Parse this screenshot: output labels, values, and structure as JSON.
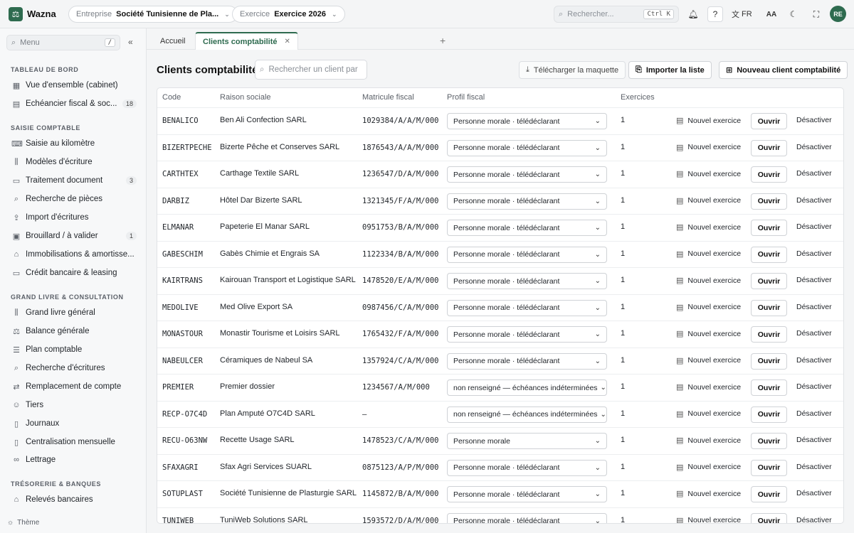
{
  "app": {
    "name": "Wazna",
    "logo_icon": "scales-icon",
    "brand_color": "#2e6b4f"
  },
  "topbar": {
    "entreprise": {
      "label": "Entreprise",
      "value": "Société Tunisienne de Pla..."
    },
    "exercice": {
      "label": "Exercice",
      "value": "Exercice 2026"
    },
    "search": {
      "placeholder": "Rechercher...",
      "shortcut": "Ctrl K"
    },
    "help": "?",
    "lang": "FR",
    "font_toggle": "AA",
    "avatar": "RE"
  },
  "sidebar": {
    "search_placeholder": "Menu",
    "search_shortcut": "/",
    "sections": [
      {
        "title": "TABLEAU DE BORD",
        "items": [
          {
            "label": "Vue d'ensemble (cabinet)",
            "icon": "grid-icon",
            "badge": ""
          },
          {
            "label": "Échéancier fiscal & soc...",
            "icon": "calendar-icon",
            "badge": "18"
          }
        ]
      },
      {
        "title": "SAISIE COMPTABLE",
        "items": [
          {
            "label": "Saisie au kilomètre",
            "icon": "keyboard-icon",
            "badge": ""
          },
          {
            "label": "Modèles d'écriture",
            "icon": "library-icon",
            "badge": ""
          },
          {
            "label": "Traitement document",
            "icon": "document-icon",
            "badge": "3"
          },
          {
            "label": "Recherche de pièces",
            "icon": "search-icon",
            "badge": ""
          },
          {
            "label": "Import d'écritures",
            "icon": "upload-icon",
            "badge": ""
          },
          {
            "label": "Brouillard / à valider",
            "icon": "clipboard-icon",
            "badge": "1"
          },
          {
            "label": "Immobilisations & amortisse...",
            "icon": "building-icon",
            "badge": ""
          },
          {
            "label": "Crédit bancaire & leasing",
            "icon": "card-icon",
            "badge": ""
          }
        ]
      },
      {
        "title": "GRAND LIVRE & CONSULTATION",
        "items": [
          {
            "label": "Grand livre général",
            "icon": "library-icon",
            "badge": ""
          },
          {
            "label": "Balance générale",
            "icon": "scales-icon",
            "badge": ""
          },
          {
            "label": "Plan comptable",
            "icon": "list-icon",
            "badge": ""
          },
          {
            "label": "Recherche d'écritures",
            "icon": "search-icon",
            "badge": ""
          },
          {
            "label": "Remplacement de compte",
            "icon": "swap-icon",
            "badge": ""
          },
          {
            "label": "Tiers",
            "icon": "users-icon",
            "badge": ""
          },
          {
            "label": "Journaux",
            "icon": "book-icon",
            "badge": ""
          },
          {
            "label": "Centralisation mensuelle",
            "icon": "file-icon",
            "badge": ""
          },
          {
            "label": "Lettrage",
            "icon": "link-icon",
            "badge": ""
          }
        ]
      },
      {
        "title": "TRÉSORERIE & BANQUES",
        "items": [
          {
            "label": "Relevés bancaires",
            "icon": "bank-icon",
            "badge": ""
          }
        ]
      }
    ],
    "theme_label": "Thème"
  },
  "tabs": [
    {
      "label": "Accueil",
      "active": false
    },
    {
      "label": "Clients comptabilité",
      "active": true
    }
  ],
  "page": {
    "title": "Clients comptabilité",
    "search_placeholder": "Rechercher un client par",
    "buttons": {
      "download": "Télécharger la maquette",
      "import": "Importer la liste",
      "new_client": "Nouveau client comptabilité"
    }
  },
  "table": {
    "headers": [
      "Code",
      "Raison sociale",
      "Matricule fiscal",
      "Profil fiscal",
      "Exercices"
    ],
    "row_actions": {
      "new_exercise": "Nouvel exercice",
      "open": "Ouvrir",
      "deactivate": "Désactiver"
    },
    "rows": [
      {
        "code": "BENALICO",
        "raison": "Ben Ali Confection SARL",
        "matricule": "1029384/A/A/M/000",
        "profil": "Personne morale · télédéclarant",
        "exercices": "1"
      },
      {
        "code": "BIZERTPECHE",
        "raison": "Bizerte Pêche et Conserves SARL",
        "matricule": "1876543/A/A/M/000",
        "profil": "Personne morale · télédéclarant",
        "exercices": "1"
      },
      {
        "code": "CARTHTEX",
        "raison": "Carthage Textile SARL",
        "matricule": "1236547/D/A/M/000",
        "profil": "Personne morale · télédéclarant",
        "exercices": "1"
      },
      {
        "code": "DARBIZ",
        "raison": "Hôtel Dar Bizerte SARL",
        "matricule": "1321345/F/A/M/000",
        "profil": "Personne morale · télédéclarant",
        "exercices": "1"
      },
      {
        "code": "ELMANAR",
        "raison": "Papeterie El Manar SARL",
        "matricule": "0951753/B/A/M/000",
        "profil": "Personne morale · télédéclarant",
        "exercices": "1"
      },
      {
        "code": "GABESCHIM",
        "raison": "Gabès Chimie et Engrais SA",
        "matricule": "1122334/B/A/M/000",
        "profil": "Personne morale · télédéclarant",
        "exercices": "1"
      },
      {
        "code": "KAIRTRANS",
        "raison": "Kairouan Transport et Logistique SARL",
        "matricule": "1478520/E/A/M/000",
        "profil": "Personne morale · télédéclarant",
        "exercices": "1"
      },
      {
        "code": "MEDOLIVE",
        "raison": "Med Olive Export SA",
        "matricule": "0987456/C/A/M/000",
        "profil": "Personne morale · télédéclarant",
        "exercices": "1"
      },
      {
        "code": "MONASTOUR",
        "raison": "Monastir Tourisme et Loisirs SARL",
        "matricule": "1765432/F/A/M/000",
        "profil": "Personne morale · télédéclarant",
        "exercices": "1"
      },
      {
        "code": "NABEULCER",
        "raison": "Céramiques de Nabeul SA",
        "matricule": "1357924/C/A/M/000",
        "profil": "Personne morale · télédéclarant",
        "exercices": "1"
      },
      {
        "code": "PREMIER",
        "raison": "Premier dossier",
        "matricule": "1234567/A/M/000",
        "profil": "non renseigné — échéances indéterminées",
        "exercices": "1"
      },
      {
        "code": "RECP-O7C4D",
        "raison": "Plan Amputé O7C4D SARL",
        "matricule": "—",
        "profil": "non renseigné — échéances indéterminées",
        "exercices": "1"
      },
      {
        "code": "RECU-O63NW",
        "raison": "Recette Usage SARL",
        "matricule": "1478523/C/A/M/000",
        "profil": "Personne morale",
        "exercices": "1"
      },
      {
        "code": "SFAXAGRI",
        "raison": "Sfax Agri Services SUARL",
        "matricule": "0875123/A/P/M/000",
        "profil": "Personne morale · télédéclarant",
        "exercices": "1"
      },
      {
        "code": "SOTUPLAST",
        "raison": "Société Tunisienne de Plasturgie SARL",
        "matricule": "1145872/B/A/M/000",
        "profil": "Personne morale · télédéclarant",
        "exercices": "1"
      },
      {
        "code": "TUNIWEB",
        "raison": "TuniWeb Solutions SARL",
        "matricule": "1593572/D/A/M/000",
        "profil": "Personne morale · télédéclarant",
        "exercices": "1"
      }
    ]
  }
}
